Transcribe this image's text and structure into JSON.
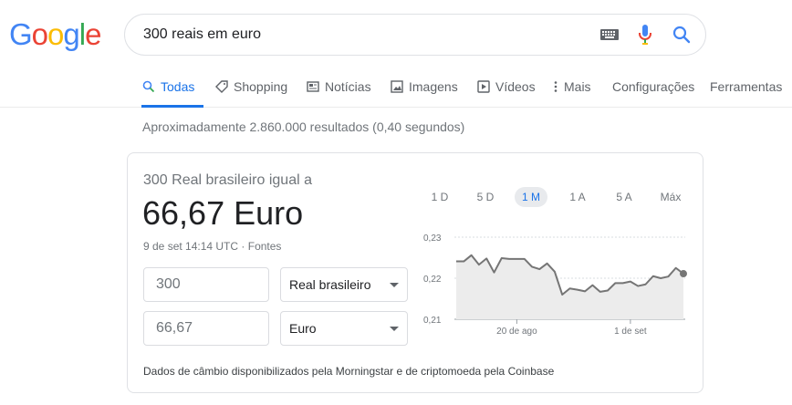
{
  "logo": [
    "G",
    "o",
    "o",
    "g",
    "l",
    "e"
  ],
  "search": {
    "query": "300 reais em euro"
  },
  "tabs": [
    {
      "label": "Todas"
    },
    {
      "label": "Shopping"
    },
    {
      "label": "Notícias"
    },
    {
      "label": "Imagens"
    },
    {
      "label": "Vídeos"
    },
    {
      "label": "Mais"
    },
    {
      "label": "Configurações"
    },
    {
      "label": "Ferramentas"
    }
  ],
  "result_stats": "Aproximadamente 2.860.000 resultados (0,40 segundos)",
  "converter": {
    "label": "300 Real brasileiro igual a",
    "value": "66,67 Euro",
    "timestamp": "9 de set 14:14 UTC",
    "sources_sep": " · ",
    "sources": "Fontes",
    "from_amount": "300",
    "from_currency": "Real brasileiro",
    "to_amount": "66,67",
    "to_currency": "Euro",
    "footnote": "Dados de câmbio disponibilizados pela Morningstar e de criptomoeda pela Coinbase"
  },
  "ranges": [
    {
      "label": "1 D"
    },
    {
      "label": "5 D"
    },
    {
      "label": "1 M",
      "active": true
    },
    {
      "label": "1 A"
    },
    {
      "label": "5 A"
    },
    {
      "label": "Máx"
    }
  ],
  "colors": {
    "accent": "#1a73e8",
    "line": "#757575",
    "fill": "#e6e6e6"
  },
  "chart_data": {
    "type": "area",
    "yticks": [
      "0,23",
      "0,22",
      "0,21"
    ],
    "ylim": [
      0.21,
      0.23
    ],
    "xticks": [
      "20 de ago",
      "1 de set"
    ],
    "xtick_index": [
      8,
      23
    ],
    "values": [
      0.2241,
      0.2241,
      0.2256,
      0.2233,
      0.2248,
      0.2214,
      0.2249,
      0.2247,
      0.2247,
      0.2247,
      0.2228,
      0.2222,
      0.2236,
      0.2216,
      0.216,
      0.2175,
      0.2172,
      0.2168,
      0.2183,
      0.2167,
      0.217,
      0.2188,
      0.2188,
      0.2192,
      0.2181,
      0.2185,
      0.2205,
      0.22,
      0.2204,
      0.2225,
      0.2211
    ]
  }
}
